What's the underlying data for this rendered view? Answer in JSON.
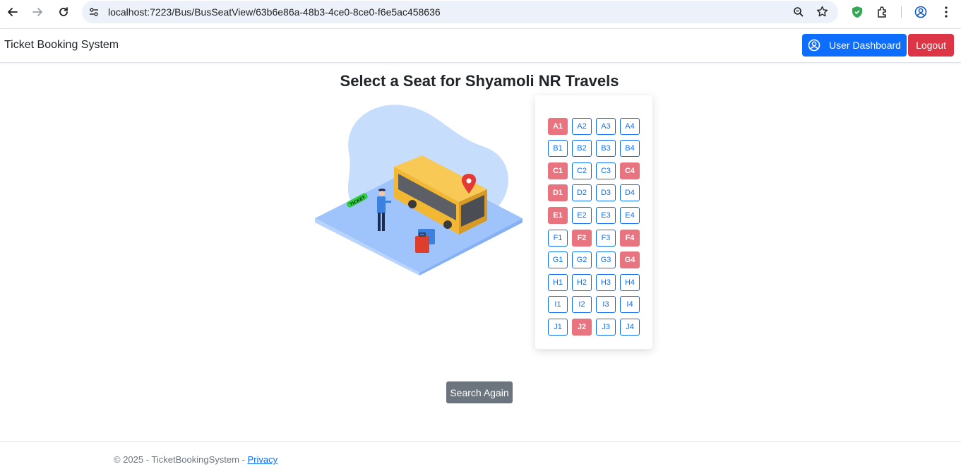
{
  "browser": {
    "url": "localhost:7223/Bus/BusSeatView/63b6e86a-48b3-4ce0-8ce0-f6e5ac458636"
  },
  "navbar": {
    "brand": "Ticket Booking System",
    "dashboard_label": "User Dashboard",
    "logout_label": "Logout"
  },
  "page": {
    "title": "Select a Seat for Shyamoli NR Travels",
    "search_again_label": "Search Again"
  },
  "illustration": {
    "ticket_text": "TICKET"
  },
  "seats": {
    "rows": [
      [
        {
          "label": "A1",
          "booked": true
        },
        {
          "label": "A2",
          "booked": false
        },
        {
          "label": "A3",
          "booked": false
        },
        {
          "label": "A4",
          "booked": false
        }
      ],
      [
        {
          "label": "B1",
          "booked": false
        },
        {
          "label": "B2",
          "booked": false
        },
        {
          "label": "B3",
          "booked": false
        },
        {
          "label": "B4",
          "booked": false
        }
      ],
      [
        {
          "label": "C1",
          "booked": true
        },
        {
          "label": "C2",
          "booked": false
        },
        {
          "label": "C3",
          "booked": false
        },
        {
          "label": "C4",
          "booked": true
        }
      ],
      [
        {
          "label": "D1",
          "booked": true
        },
        {
          "label": "D2",
          "booked": false
        },
        {
          "label": "D3",
          "booked": false
        },
        {
          "label": "D4",
          "booked": false
        }
      ],
      [
        {
          "label": "E1",
          "booked": true
        },
        {
          "label": "E2",
          "booked": false
        },
        {
          "label": "E3",
          "booked": false
        },
        {
          "label": "E4",
          "booked": false
        }
      ],
      [
        {
          "label": "F1",
          "booked": false
        },
        {
          "label": "F2",
          "booked": true
        },
        {
          "label": "F3",
          "booked": false
        },
        {
          "label": "F4",
          "booked": true
        }
      ],
      [
        {
          "label": "G1",
          "booked": false
        },
        {
          "label": "G2",
          "booked": false
        },
        {
          "label": "G3",
          "booked": false
        },
        {
          "label": "G4",
          "booked": true
        }
      ],
      [
        {
          "label": "H1",
          "booked": false
        },
        {
          "label": "H2",
          "booked": false
        },
        {
          "label": "H3",
          "booked": false
        },
        {
          "label": "H4",
          "booked": false
        }
      ],
      [
        {
          "label": "I1",
          "booked": false
        },
        {
          "label": "I2",
          "booked": false
        },
        {
          "label": "I3",
          "booked": false
        },
        {
          "label": "I4",
          "booked": false
        }
      ],
      [
        {
          "label": "J1",
          "booked": false
        },
        {
          "label": "J2",
          "booked": true
        },
        {
          "label": "J3",
          "booked": false
        },
        {
          "label": "J4",
          "booked": false
        }
      ]
    ]
  },
  "footer": {
    "text": "© 2025 - TicketBookingSystem - ",
    "privacy_label": "Privacy"
  },
  "colors": {
    "primary": "#0d6efd",
    "danger": "#dc3545",
    "booked_seat": "#e8747f",
    "secondary": "#6c757d"
  }
}
